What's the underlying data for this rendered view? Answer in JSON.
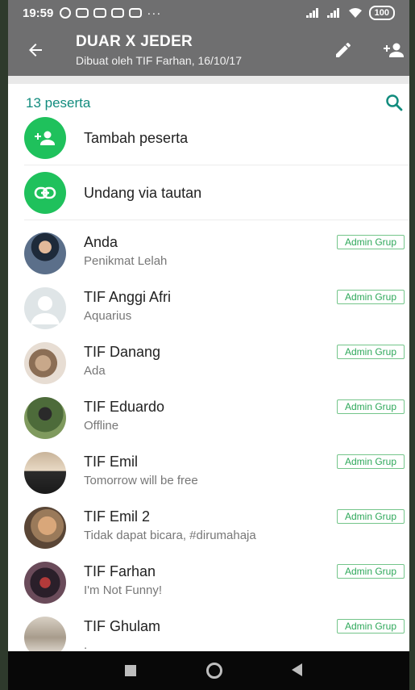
{
  "statusbar": {
    "time": "19:59",
    "notifications": [
      "whatsapp-icon",
      "discord-icon",
      "discord-icon",
      "discord-icon",
      "discord-icon"
    ],
    "more": "···",
    "battery": "100"
  },
  "header": {
    "title": "DUAR X JEDER",
    "subtitle": "Dibuat oleh TIF Farhan, 16/10/17"
  },
  "participants": {
    "count_label": "13 peserta"
  },
  "actions": [
    {
      "label": "Tambah peserta",
      "icon": "add-person-icon"
    },
    {
      "label": "Undang via tautan",
      "icon": "link-icon"
    }
  ],
  "members": [
    {
      "name": "Anda",
      "status": "Penikmat Lelah",
      "badge": "Admin Grup"
    },
    {
      "name": "TIF Anggi Afri",
      "status": "Aquarius",
      "badge": "Admin Grup"
    },
    {
      "name": "TIF Danang",
      "status": "Ada",
      "badge": "Admin Grup"
    },
    {
      "name": "TIF Eduardo",
      "status": "Offline",
      "badge": "Admin Grup"
    },
    {
      "name": "TIF Emil",
      "status": "Tomorrow will be free",
      "badge": "Admin Grup"
    },
    {
      "name": "TIF Emil 2",
      "status": "Tidak dapat bicara, #dirumahaja",
      "badge": "Admin Grup"
    },
    {
      "name": "TIF Farhan",
      "status": "I'm Not Funny!",
      "badge": "Admin Grup"
    },
    {
      "name": "TIF Ghulam",
      "status": ".",
      "badge": "Admin Grup"
    }
  ],
  "colors": {
    "header": "#6f6f70",
    "accent": "#128c7e",
    "action_green": "#1fc15c",
    "badge_green": "#2ea85a"
  }
}
